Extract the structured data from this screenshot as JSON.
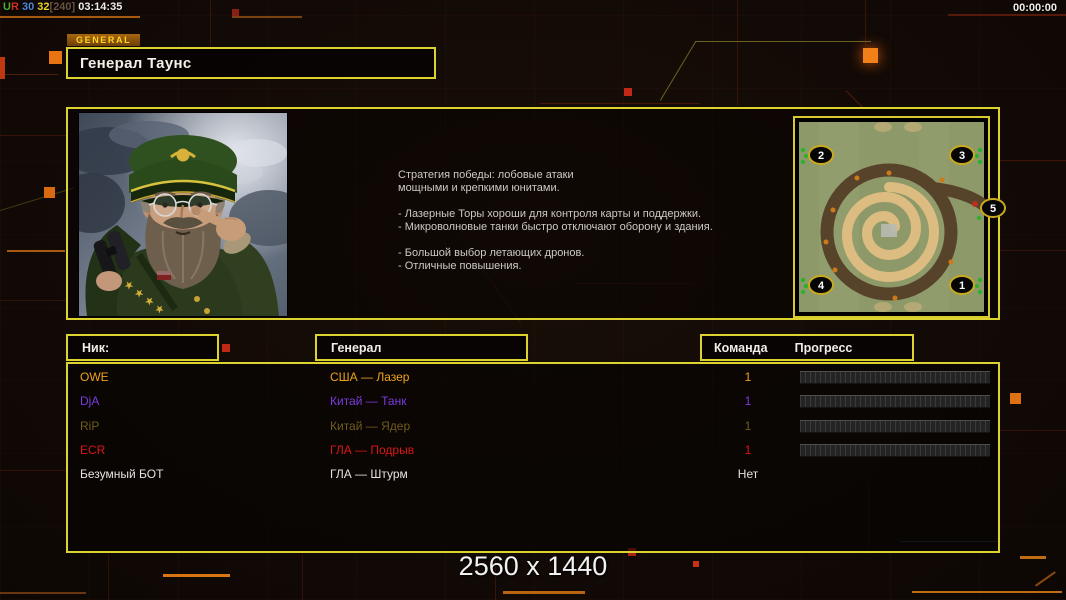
{
  "status_bar": {
    "net_u": "U",
    "net_r": "R",
    "val_blue": "30",
    "val_yellow": "32",
    "val_limit": "[240]",
    "clock": "03:14:35",
    "match_timer": "00:00:00"
  },
  "header": {
    "tab_label": "GENERAL",
    "title": "Генерал Таунс"
  },
  "general_info": {
    "description": "Стратегия победы: лобовые атаки\nмощными и крепкими юнитами.\n\n- Лазерные Торы хороши для контроля карты и поддержки.\n- Микроволновые танки быстро отключают оборону и здания.\n\n- Большой выбор летающих дронов.\n- Отличные повышения."
  },
  "map": {
    "marker_labels": [
      "2",
      "3",
      "5",
      "4",
      "1"
    ]
  },
  "table": {
    "headers": {
      "nick": "Ник:",
      "general": "Генерал",
      "team": "Команда",
      "progress": "Прогресс"
    },
    "rows": [
      {
        "nick": "OWE",
        "general": "США — Лазер",
        "team": "1",
        "color": "#eda41c",
        "has_progress": true
      },
      {
        "nick": "DjA",
        "general": "Китай — Танк",
        "team": "1",
        "color": "#7b3be0",
        "has_progress": true
      },
      {
        "nick": "RiP",
        "general": "Китай — Ядер",
        "team": "1",
        "color": "#6f5c1e",
        "has_progress": true
      },
      {
        "nick": "ECR",
        "general": "ГЛА — Подрыв",
        "team": "1",
        "color": "#d81616",
        "has_progress": true
      },
      {
        "nick": "Безумный БОТ",
        "general": "ГЛА — Штурм",
        "team": "Нет",
        "color": "#e4e2de",
        "has_progress": false
      }
    ]
  },
  "footer": {
    "resolution": "2560 x 1440"
  },
  "colors": {
    "panel_border": "#ddd32f",
    "accent_orange": "#e87414",
    "map_ground": "#8d9968"
  }
}
